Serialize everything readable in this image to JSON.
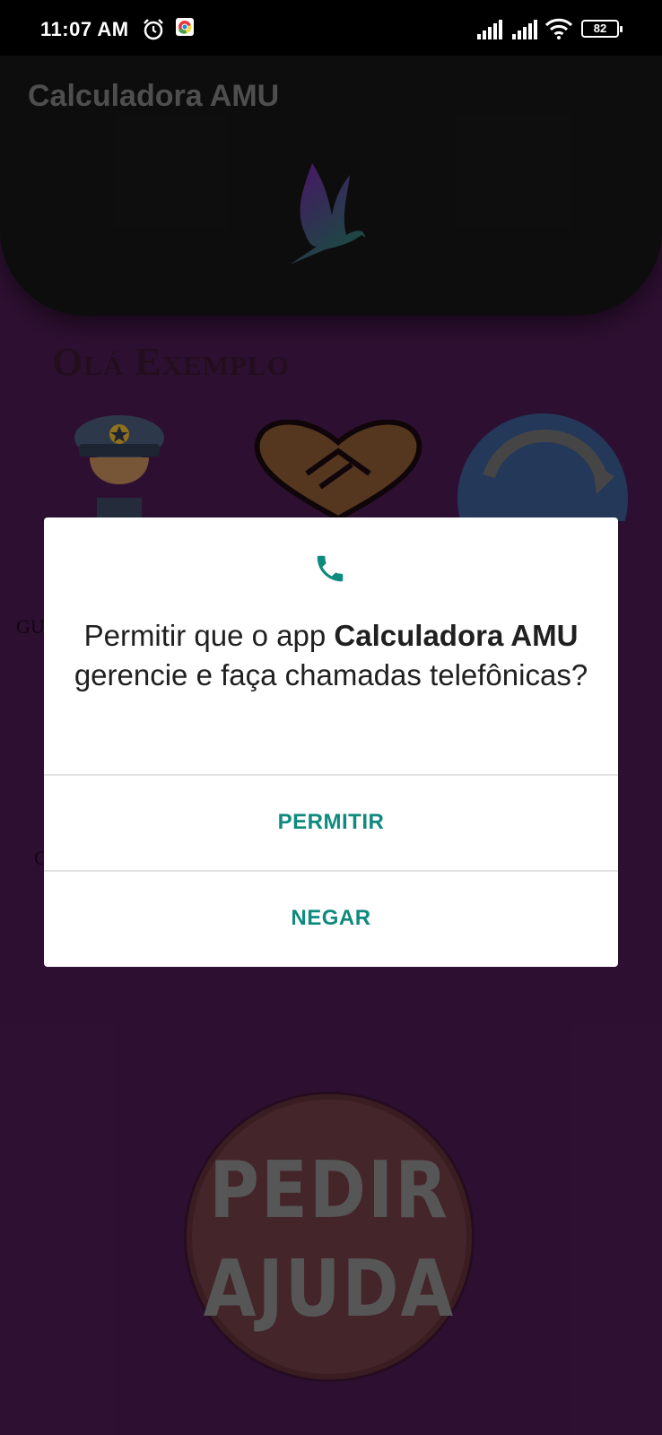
{
  "status_bar": {
    "time": "11:07 AM",
    "battery": "82",
    "icons": [
      "alarm-icon",
      "chrome-icon",
      "signal-icon",
      "signal-icon",
      "wifi-icon",
      "battery-icon"
    ]
  },
  "app_bar": {
    "title": "Calculadora AMU",
    "logo_icon": "bird-logo-icon"
  },
  "main": {
    "greeting": "Olá Exemplo",
    "tiles": [
      "police-icon",
      "handshake-heart-icon",
      "refresh-icon"
    ],
    "side_text_1": "GU",
    "side_text_2": "C",
    "help_button": {
      "line1": "PEDIR",
      "line2": "AJUDA"
    }
  },
  "dialog": {
    "icon": "phone-icon",
    "message_prefix": "Permitir que o app ",
    "app_name": "Calculadora AMU",
    "message_suffix": " gerencie e faça chamadas telefônicas?",
    "allow_label": "PERMITIR",
    "deny_label": "NEGAR"
  },
  "colors": {
    "background": "#4a1a50",
    "header": "#161616",
    "accent": "#0f8a7e",
    "help_button": "#6e3c44"
  }
}
